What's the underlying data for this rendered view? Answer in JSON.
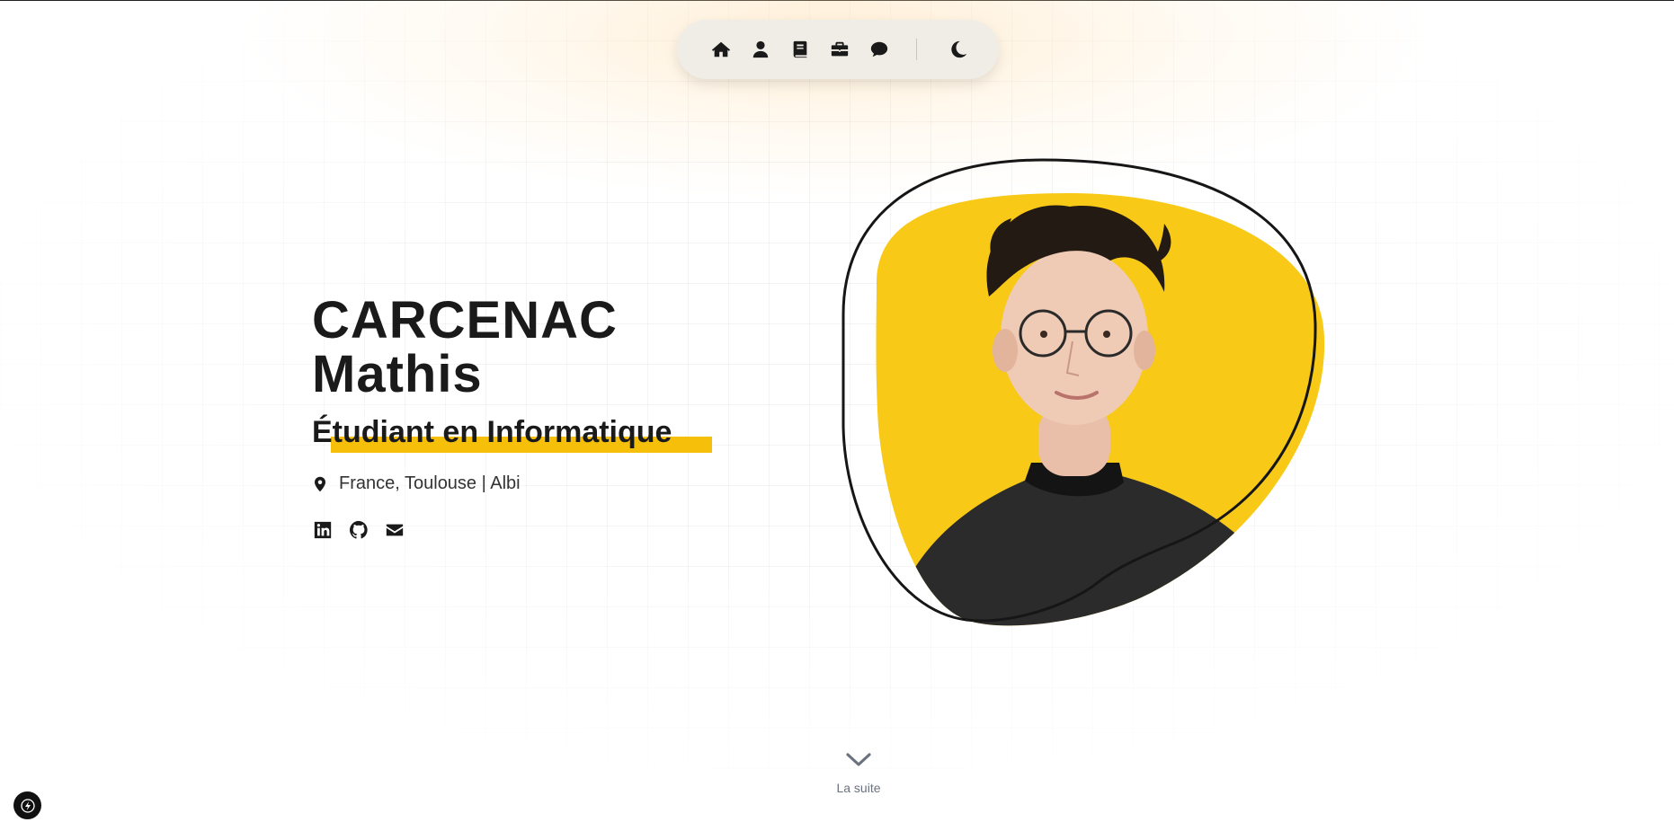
{
  "nav": {
    "items": [
      {
        "icon": "home-icon"
      },
      {
        "icon": "user-icon"
      },
      {
        "icon": "book-icon"
      },
      {
        "icon": "briefcase-icon"
      },
      {
        "icon": "chat-icon"
      }
    ],
    "theme_toggle_icon": "moon-icon"
  },
  "hero": {
    "last_name": "CARCENAC",
    "first_name": "Mathis",
    "role": "Étudiant en Informatique",
    "location": "France, Toulouse | Albi",
    "socials": [
      {
        "icon": "linkedin-icon"
      },
      {
        "icon": "github-icon"
      },
      {
        "icon": "mail-icon"
      }
    ]
  },
  "scroll": {
    "label": "La suite"
  },
  "colors": {
    "accent": "#f5bf0a",
    "blob": "#f8c916",
    "navbar_bg": "#f0ece6",
    "text": "#1a1a1a"
  }
}
